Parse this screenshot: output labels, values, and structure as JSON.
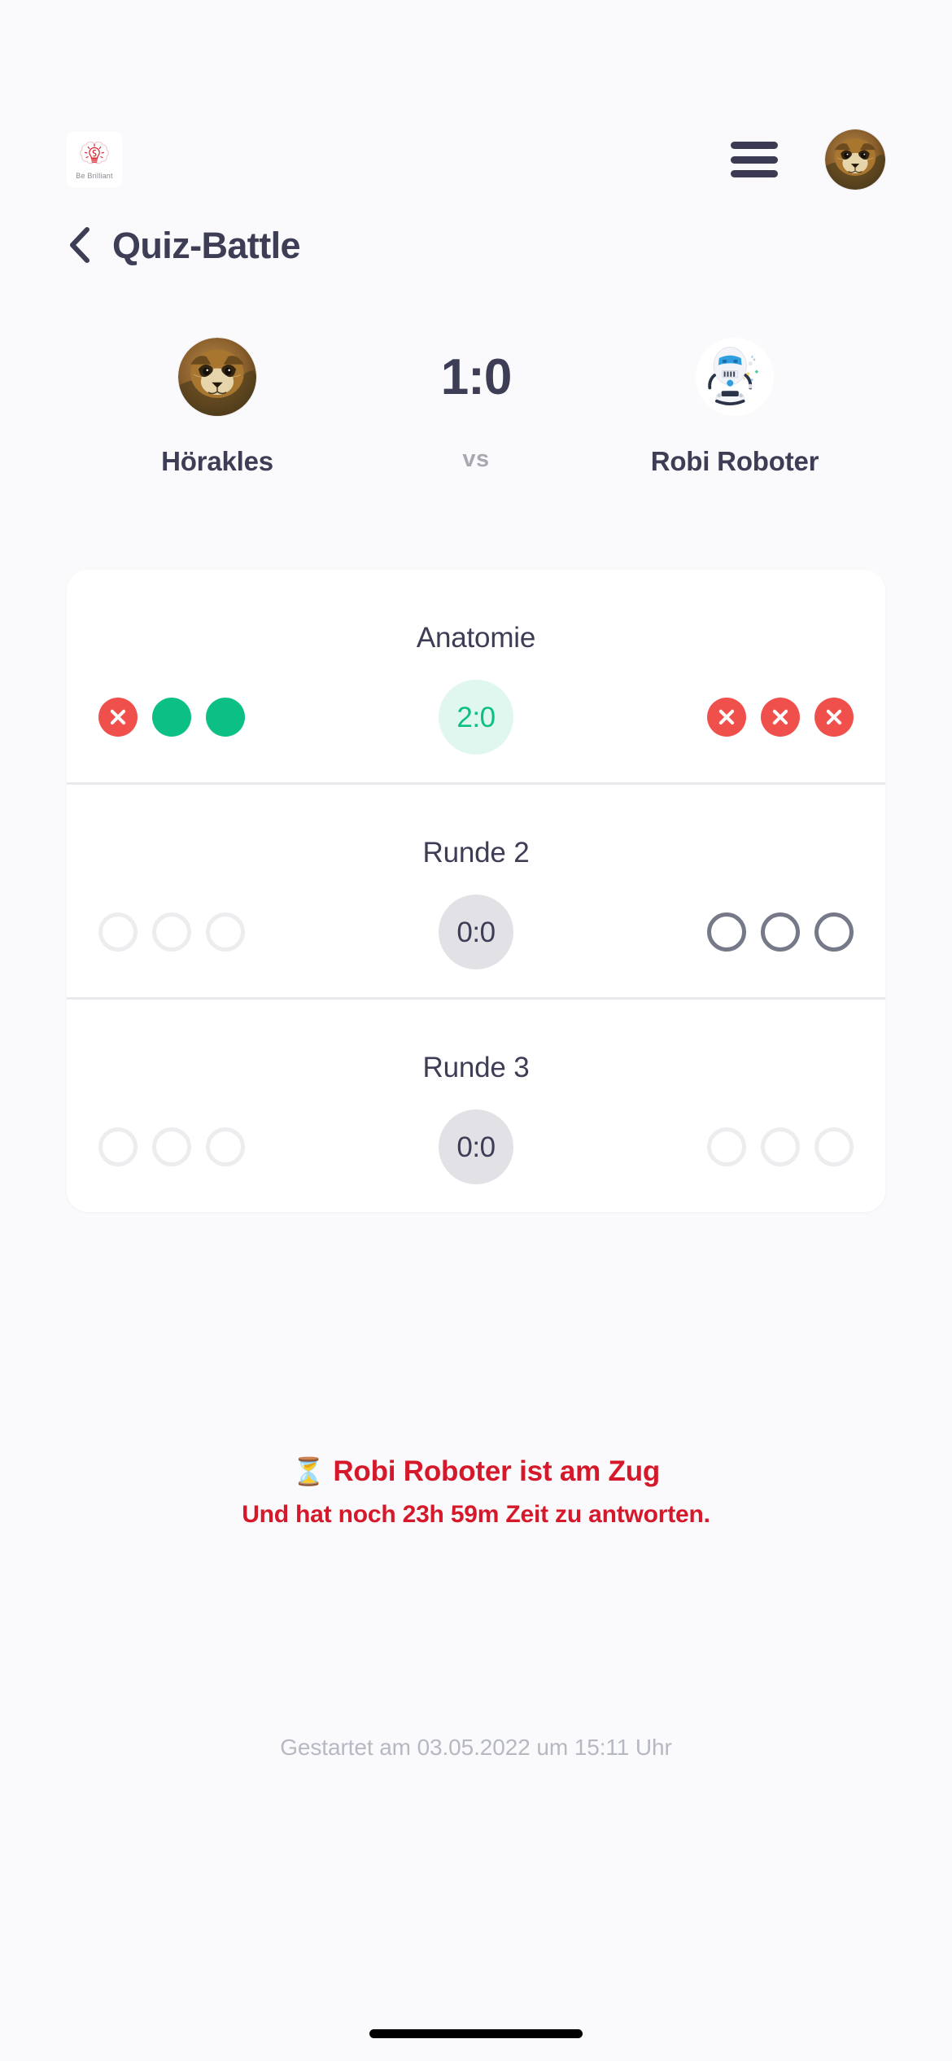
{
  "brand": {
    "logo_icon": "brain-lightbulb-icon",
    "tagline": "Be Brilliant"
  },
  "header": {
    "menu_icon": "hamburger-menu-icon",
    "avatar_icon": "user-avatar-raccoon",
    "menu_color": "#3a3a52"
  },
  "page": {
    "back_icon": "chevron-left-icon",
    "title": "Quiz-Battle"
  },
  "versus": {
    "player_left": {
      "name": "Hörakles",
      "avatar_icon": "avatar-raccoon"
    },
    "player_right": {
      "name": "Robi Roboter",
      "avatar_icon": "avatar-robot"
    },
    "score": "1:0",
    "separator_label": "vs"
  },
  "rounds": [
    {
      "title": "Anatomie",
      "score": "2:0",
      "score_state": "win",
      "left_dots": [
        "wrong",
        "correct",
        "correct"
      ],
      "right_dots": [
        "wrong",
        "wrong",
        "wrong"
      ]
    },
    {
      "title": "Runde 2",
      "score": "0:0",
      "score_state": "idle",
      "left_dots": [
        "empty",
        "empty",
        "empty"
      ],
      "right_dots": [
        "pending",
        "pending",
        "pending"
      ]
    },
    {
      "title": "Runde 3",
      "score": "0:0",
      "score_state": "idle",
      "left_dots": [
        "empty",
        "empty",
        "empty"
      ],
      "right_dots": [
        "empty",
        "empty",
        "empty"
      ]
    }
  ],
  "status": {
    "icon": "hourglass-icon",
    "icon_glyph": "⏳",
    "main": "Robi Roboter ist am Zug",
    "sub": "Und hat noch 23h 59m Zeit zu antworten.",
    "color": "#d6192a"
  },
  "footer": {
    "started_note": "Gestartet am 03.05.2022 um 15:11 Uhr"
  },
  "colors": {
    "background": "#fafafc",
    "card": "#ffffff",
    "text_dark": "#3d3d56",
    "correct": "#0cbf84",
    "wrong": "#f0504b",
    "muted": "#b6b8c2",
    "pending_ring": "#767a88",
    "empty_ring": "#ededf0"
  }
}
